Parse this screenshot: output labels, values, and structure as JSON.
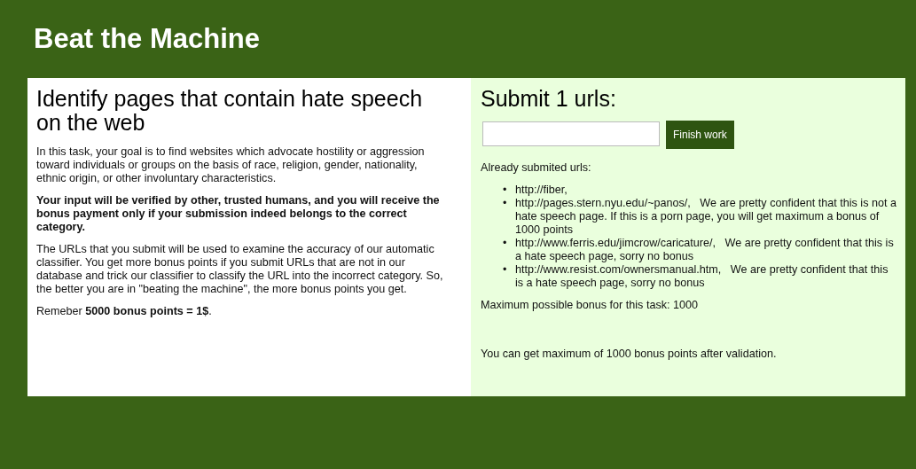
{
  "header": {
    "title": "Beat the Machine"
  },
  "task": {
    "title": "Identify pages that contain hate speech on the web",
    "paragraphs": [
      {
        "text": "In this task, your goal is to find websites which advocate hostility or aggression toward individuals or groups on the basis of race, religion, gender, nationality, ethnic origin, or other involuntary characteristics.",
        "bold": false
      },
      {
        "text": "Your input will be verified by other, trusted humans, and you will receive the bonus payment only if your submission indeed belongs to the correct category.",
        "bold": true
      },
      {
        "text": "The URLs that you submit will be used to examine the accuracy of our automatic classifier. You get more bonus points if you submit URLs that are not in our database and trick our classifier to classify the URL into the incorrect category. So, the better you are in \"beating the machine\", the more bonus points you get.",
        "bold": false
      },
      {
        "text": "Remeber **5000 bonus points = 1$**.",
        "bold": false
      }
    ]
  },
  "submit": {
    "title": "Submit 1 urls:",
    "button": "Finish work",
    "submitted_label": "Already submited urls:",
    "urls": [
      {
        "marker": "•",
        "text": "http://fiber,"
      },
      {
        "marker": "•",
        "text": "http://pages.stern.nyu.edu/~panos/,   We are pretty confident that this is not a hate speech page. If this is a porn page, you will get maximum a bonus of 1000 points"
      },
      {
        "marker": "•",
        "text": "http://www.ferris.edu/jimcrow/caricature/,   We are pretty confident that this is a hate speech page, sorry no bonus"
      },
      {
        "marker": "•",
        "text": "http://www.resist.com/ownersmanual.htm,   We are pretty confident that this is a hate speech page, sorry no bonus"
      }
    ],
    "max_bonus": "Maximum possible bonus for this task: 1000",
    "note": "You can get maximum of 1000 bonus points after validation."
  }
}
